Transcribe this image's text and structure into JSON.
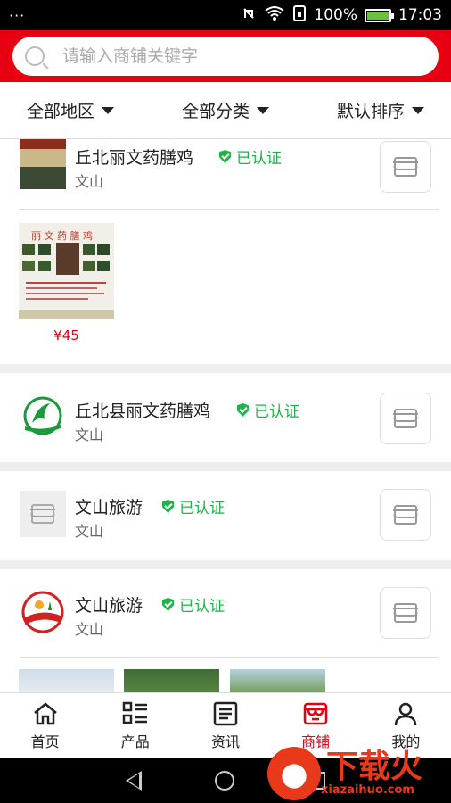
{
  "status": {
    "left": "···",
    "battery": "100%",
    "time": "17:03"
  },
  "search": {
    "placeholder": "请输入商铺关键字"
  },
  "filters": [
    {
      "label": "全部地区"
    },
    {
      "label": "全部分类"
    },
    {
      "label": "默认排序"
    }
  ],
  "shops": [
    {
      "name": "丘北丽文药膳鸡",
      "verified": "已认证",
      "city": "文山"
    },
    {
      "name": "丘北县丽文药膳鸡",
      "verified": "已认证",
      "city": "文山"
    },
    {
      "name": "文山旅游",
      "verified": "已认证",
      "city": "文山"
    },
    {
      "name": "文山旅游",
      "verified": "已认证",
      "city": "文山"
    }
  ],
  "products": [
    {
      "price": "¥45"
    }
  ],
  "nav": [
    {
      "label": "首页",
      "icon": "home-icon"
    },
    {
      "label": "产品",
      "icon": "list-icon"
    },
    {
      "label": "资讯",
      "icon": "news-icon"
    },
    {
      "label": "商铺",
      "icon": "store-icon"
    },
    {
      "label": "我的",
      "icon": "user-icon"
    }
  ],
  "watermark": {
    "title": "下载火",
    "url": "xiazaihuo.com"
  },
  "colors": {
    "brand": "#e60012",
    "verified": "#22b14c"
  }
}
